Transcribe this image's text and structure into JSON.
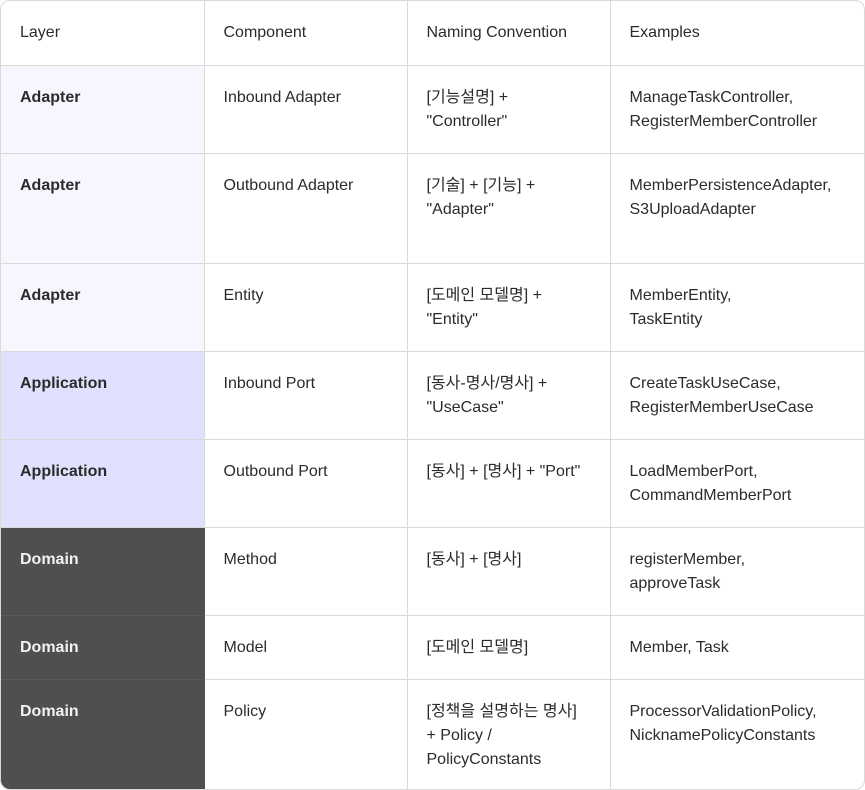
{
  "header": {
    "layer": "Layer",
    "component": "Component",
    "naming": "Naming Convention",
    "examples": "Examples"
  },
  "rows": [
    {
      "layer": "Adapter",
      "component": "Inbound Adapter",
      "naming": "[기능설명] +\n\"Controller\"",
      "examples": "ManageTaskController,\nRegisterMemberController"
    },
    {
      "layer": "Adapter",
      "component": "Outbound Adapter",
      "naming": "[기술] + [기능] +\n\"Adapter\"",
      "examples": "MemberPersistenceAdapter,\nS3UploadAdapter"
    },
    {
      "layer": "Adapter",
      "component": "Entity",
      "naming": "[도메인 모델명] +\n\"Entity\"",
      "examples": "MemberEntity,\nTaskEntity"
    },
    {
      "layer": "Application",
      "component": "Inbound Port",
      "naming": "[동사-명사/명사] +\n\"UseCase\"",
      "examples": "CreateTaskUseCase,\nRegisterMemberUseCase"
    },
    {
      "layer": "Application",
      "component": "Outbound Port",
      "naming": "[동사] + [명사] + \"Port\"",
      "examples": "LoadMemberPort,\nCommandMemberPort"
    },
    {
      "layer": "Domain",
      "component": "Method",
      "naming": "[동사] + [명사]",
      "examples": "registerMember,\napproveTask"
    },
    {
      "layer": "Domain",
      "component": "Model",
      "naming": "[도메인 모델명]",
      "examples": "Member, Task"
    },
    {
      "layer": "Domain",
      "component": "Policy",
      "naming": "[정책을 설명하는 명사]\n+ Policy /\nPolicyConstants",
      "examples": "ProcessorValidationPolicy,\nNicknamePolicyConstants"
    }
  ],
  "colors": {
    "adapter": "#f6f6ff",
    "application": "#e0e0ff",
    "domain": "#4f4f4f",
    "border": "#d9d9d9"
  }
}
